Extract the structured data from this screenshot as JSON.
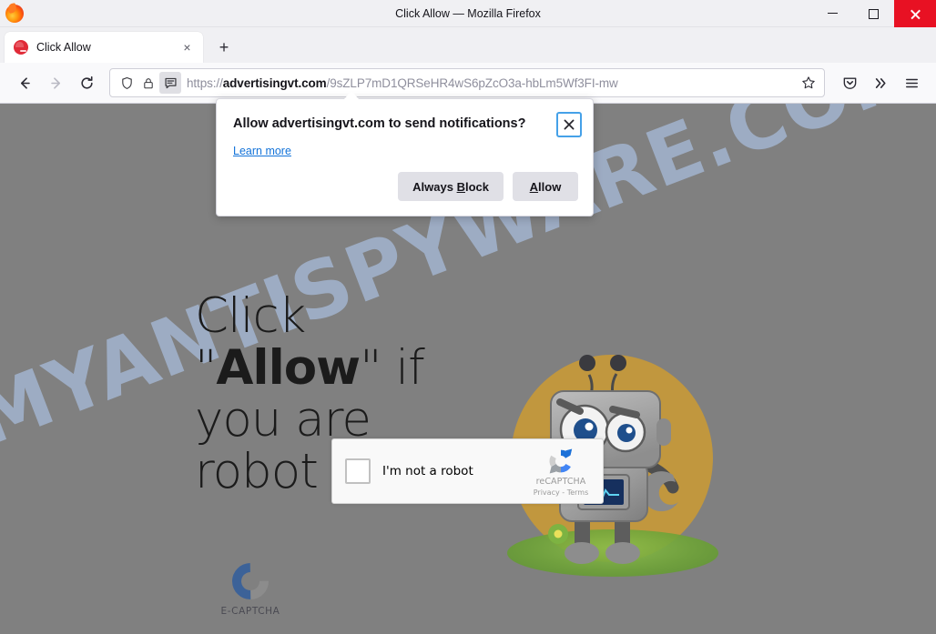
{
  "window": {
    "title": "Click Allow — Mozilla Firefox",
    "minimize_label": "Minimize",
    "maximize_label": "Maximize",
    "close_label": "Close"
  },
  "tabs": {
    "items": [
      {
        "title": "Click Allow",
        "favicon": "red-circle-favicon",
        "close_label": "×"
      }
    ],
    "new_tab_label": "+"
  },
  "toolbar": {
    "back_label": "←",
    "forward_label": "→",
    "reload_label": "⟳",
    "shield_icon": "shield-icon",
    "lock_icon": "padlock-icon",
    "notification_icon": "notification-bubble-icon",
    "bookmark_icon": "star-icon",
    "pocket_icon": "pocket-icon",
    "overflow_label": "»",
    "menu_icon": "hamburger-menu-icon"
  },
  "url": {
    "scheme": "https://",
    "domain": "advertisingvt.com",
    "path": "/9sZLP7mD1QRSeHR4wS6pZcO3a-hbLm5Wf3FI-mw"
  },
  "doorhanger": {
    "title": "Allow advertisingvt.com to send notifications?",
    "learn_more": "Learn more",
    "close_label": "✕",
    "buttons": {
      "block_prefix": "Always ",
      "block_accel": "B",
      "block_suffix": "lock",
      "allow_accel": "A",
      "allow_suffix": "llow"
    }
  },
  "page": {
    "watermark": "MYANTISPYWARE.COM",
    "headline": {
      "part1": "Click \"",
      "emphasis": "Allow",
      "part2": "\" if you are robot"
    },
    "ecaptcha": {
      "label": "E-CAPTCHA",
      "mark": "c-logo-icon",
      "blue": "#3c6298",
      "gray": "#8c8c8c"
    },
    "recaptcha": {
      "checkbox_label": "I'm not a robot",
      "brand": "reCAPTCHA",
      "privacy": "Privacy",
      "separator": " - ",
      "terms": "Terms",
      "logo": "recaptcha-logo-icon"
    },
    "robot": {
      "alt": "gray-robot-mascot",
      "background_color": "#c99a34",
      "ground_color": "#6ea238"
    },
    "background_color": "#808080"
  }
}
